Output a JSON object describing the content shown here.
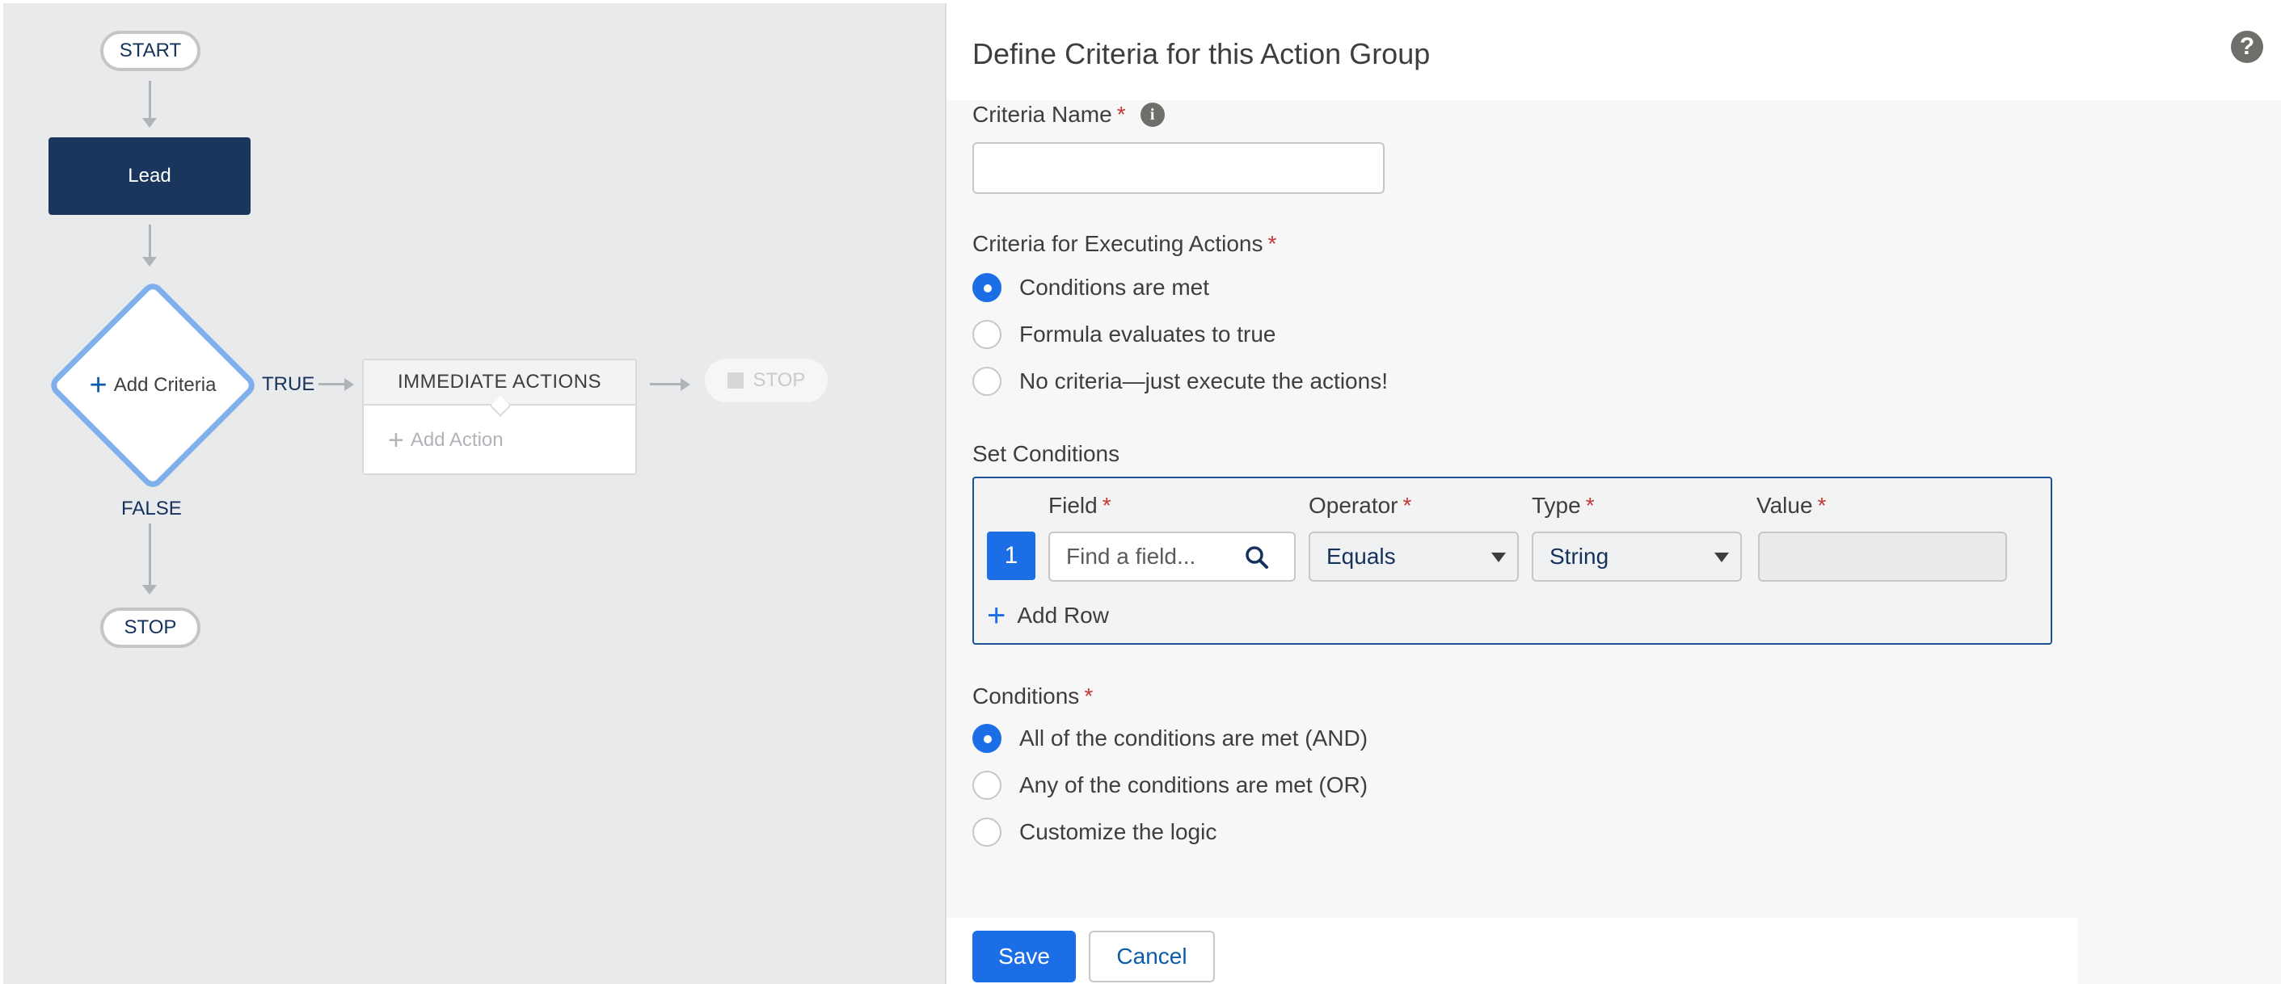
{
  "canvas": {
    "start_label": "START",
    "object_node": "Lead",
    "criteria_node": {
      "plus": "+",
      "label": "Add Criteria"
    },
    "true_label": "TRUE",
    "false_label": "FALSE",
    "immediate_actions": {
      "header": "IMMEDIATE ACTIONS",
      "plus": "+",
      "add_action": "Add Action"
    },
    "stop_ghost": "STOP",
    "stop_label": "STOP"
  },
  "panel": {
    "title": "Define Criteria for this Action Group",
    "help_icon": "?",
    "criteria_name": {
      "label": "Criteria Name",
      "required": "*",
      "info_icon": "i",
      "value": ""
    },
    "executing": {
      "label": "Criteria for Executing Actions",
      "required": "*",
      "options": [
        {
          "label": "Conditions are met",
          "selected": true
        },
        {
          "label": "Formula evaluates to true",
          "selected": false
        },
        {
          "label": "No criteria—just execute the actions!",
          "selected": false
        }
      ]
    },
    "set_conditions": {
      "label": "Set Conditions",
      "columns": {
        "field": "Field",
        "operator": "Operator",
        "type": "Type",
        "value": "Value",
        "required": "*"
      },
      "row": {
        "number": "1",
        "field_placeholder": "Find a field...",
        "operator": "Equals",
        "type": "String",
        "value": ""
      },
      "add_row": {
        "plus": "+",
        "label": "Add Row"
      }
    },
    "conditions": {
      "label": "Conditions",
      "required": "*",
      "options": [
        {
          "label": "All of the conditions are met (AND)",
          "selected": true
        },
        {
          "label": "Any of the conditions are met (OR)",
          "selected": false
        },
        {
          "label": "Customize the logic",
          "selected": false
        }
      ]
    },
    "footer": {
      "save": "Save",
      "cancel": "Cancel"
    }
  },
  "colors": {
    "brand": "#1b6ee5",
    "node_dark": "#1b365d",
    "diamond_border": "#7fb0ec",
    "required": "#c23934"
  }
}
